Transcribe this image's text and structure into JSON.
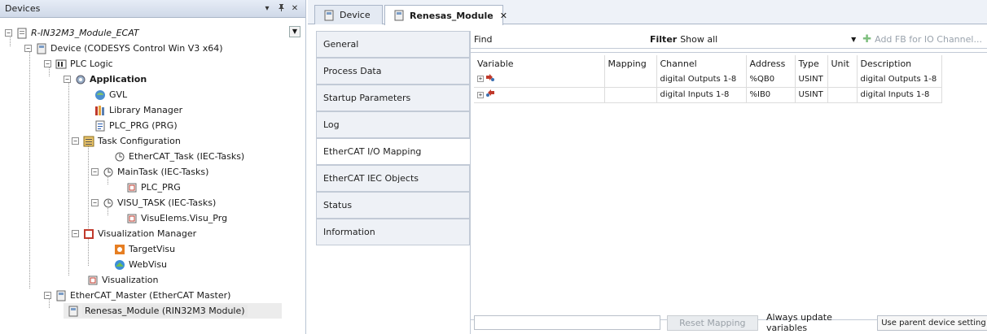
{
  "devices_panel": {
    "title": "Devices",
    "pin_glyph": "▾",
    "dock_glyph": "ᵖ",
    "close_glyph": "✕",
    "tree": [
      {
        "label": "R-IN32M3_Module_ECAT",
        "icon": "project-icon",
        "style": "italic"
      },
      {
        "label": "Device (CODESYS Control Win V3 x64)",
        "icon": "device-icon"
      },
      {
        "label": "PLC Logic",
        "icon": "plc-logic-icon"
      },
      {
        "label": "Application",
        "icon": "application-gear-icon",
        "style": "bold"
      },
      {
        "label": "GVL",
        "icon": "gvl-icon"
      },
      {
        "label": "Library Manager",
        "icon": "library-icon"
      },
      {
        "label": "PLC_PRG (PRG)",
        "icon": "pou-icon"
      },
      {
        "label": "Task Configuration",
        "icon": "task-config-icon"
      },
      {
        "label": "EtherCAT_Task (IEC-Tasks)",
        "icon": "task-icon"
      },
      {
        "label": "MainTask (IEC-Tasks)",
        "icon": "task-icon"
      },
      {
        "label": "PLC_PRG",
        "icon": "program-call-icon"
      },
      {
        "label": "VISU_TASK (IEC-Tasks)",
        "icon": "task-icon"
      },
      {
        "label": "VisuElems.Visu_Prg",
        "icon": "program-call-icon"
      },
      {
        "label": "Visualization Manager",
        "icon": "visu-manager-icon"
      },
      {
        "label": "TargetVisu",
        "icon": "target-visu-icon"
      },
      {
        "label": "WebVisu",
        "icon": "web-visu-icon"
      },
      {
        "label": "Visualization",
        "icon": "visualization-icon"
      },
      {
        "label": "EtherCAT_Master (EtherCAT Master)",
        "icon": "device-icon"
      },
      {
        "label": "Renesas_Module (RIN32M3 Module)",
        "icon": "device-icon"
      }
    ]
  },
  "doc_tabs": [
    {
      "label": "Device"
    },
    {
      "label": "Renesas_Module",
      "close": "✕"
    }
  ],
  "vertical_tabs": [
    "General",
    "Process Data",
    "Startup Parameters",
    "Log",
    "EtherCAT I/O Mapping",
    "EtherCAT IEC Objects",
    "Status",
    "Information"
  ],
  "active_vertical_tab": "EtherCAT I/O Mapping",
  "find_bar": {
    "find_label": "Find",
    "filter_label": "Filter",
    "filter_value": "Show all",
    "add_fb_label": "Add FB for IO Channel..."
  },
  "table": {
    "columns": [
      "Variable",
      "Mapping",
      "Channel",
      "Address",
      "Type",
      "Unit",
      "Description"
    ],
    "rows": [
      {
        "variable": "",
        "mapping": "",
        "channel": "digital Outputs 1-8",
        "address": "%QB0",
        "type": "USINT",
        "unit": "",
        "description": "digital Outputs 1-8",
        "icon": "output-channel-icon"
      },
      {
        "variable": "",
        "mapping": "",
        "channel": "digital Inputs 1-8",
        "address": "%IB0",
        "type": "USINT",
        "unit": "",
        "description": "digital Inputs 1-8",
        "icon": "input-channel-icon"
      }
    ]
  },
  "bottom_bar": {
    "reset_label": "Reset Mapping",
    "always_label": "Always update variables",
    "parent_value": "Use parent device setting"
  },
  "colors": {
    "header_gradient_top": "#e6ecf6",
    "border": "#aab6c8",
    "disabled_text": "#9aa3ad"
  }
}
